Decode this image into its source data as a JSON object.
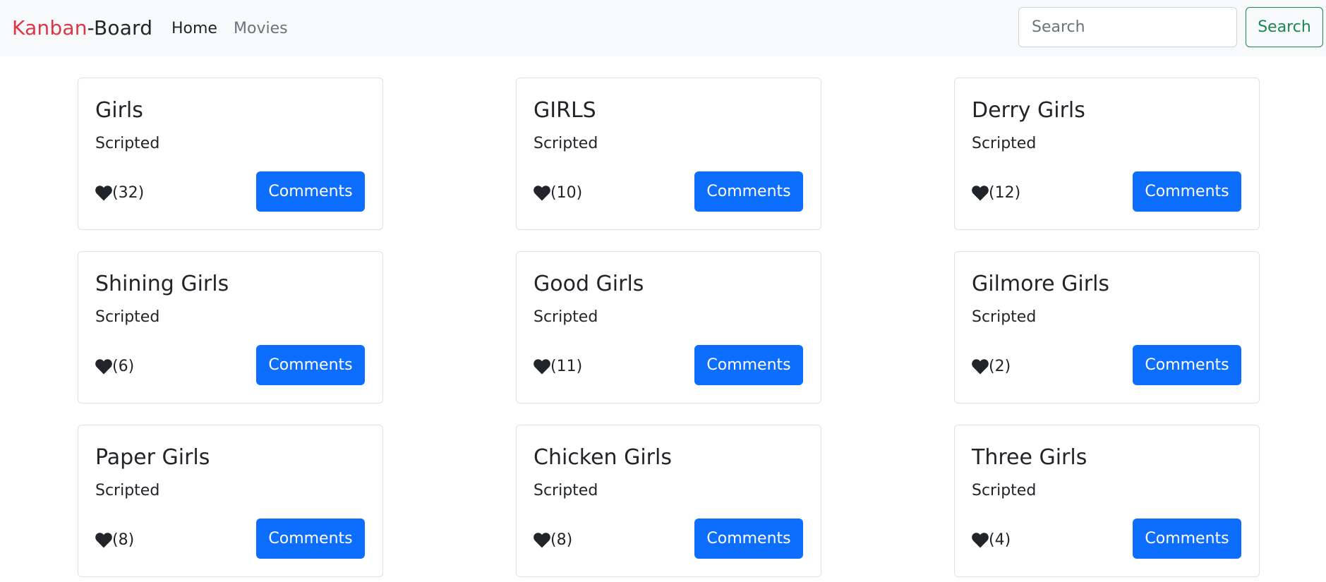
{
  "navbar": {
    "brand_part1": "Kanban",
    "brand_part2": "-Board",
    "links": [
      {
        "label": "Home",
        "active": true
      },
      {
        "label": "Movies",
        "active": false
      }
    ],
    "search": {
      "placeholder": "Search",
      "value": "",
      "button_label": "Search"
    }
  },
  "colors": {
    "brand_accent": "#dc3545",
    "primary_button": "#0d6efd",
    "search_button": "#198754"
  },
  "cards": [
    {
      "title": "Girls",
      "genre": "Scripted",
      "likes": "(32)",
      "button": "Comments"
    },
    {
      "title": "GIRLS",
      "genre": "Scripted",
      "likes": "(10)",
      "button": "Comments"
    },
    {
      "title": "Derry Girls",
      "genre": "Scripted",
      "likes": "(12)",
      "button": "Comments"
    },
    {
      "title": "Shining Girls",
      "genre": "Scripted",
      "likes": "(6)",
      "button": "Comments"
    },
    {
      "title": "Good Girls",
      "genre": "Scripted",
      "likes": "(11)",
      "button": "Comments"
    },
    {
      "title": "Gilmore Girls",
      "genre": "Scripted",
      "likes": "(2)",
      "button": "Comments"
    },
    {
      "title": "Paper Girls",
      "genre": "Scripted",
      "likes": "(8)",
      "button": "Comments"
    },
    {
      "title": "Chicken Girls",
      "genre": "Scripted",
      "likes": "(8)",
      "button": "Comments"
    },
    {
      "title": "Three Girls",
      "genre": "Scripted",
      "likes": "(4)",
      "button": "Comments"
    }
  ],
  "icons": {
    "like": "heart-icon"
  }
}
